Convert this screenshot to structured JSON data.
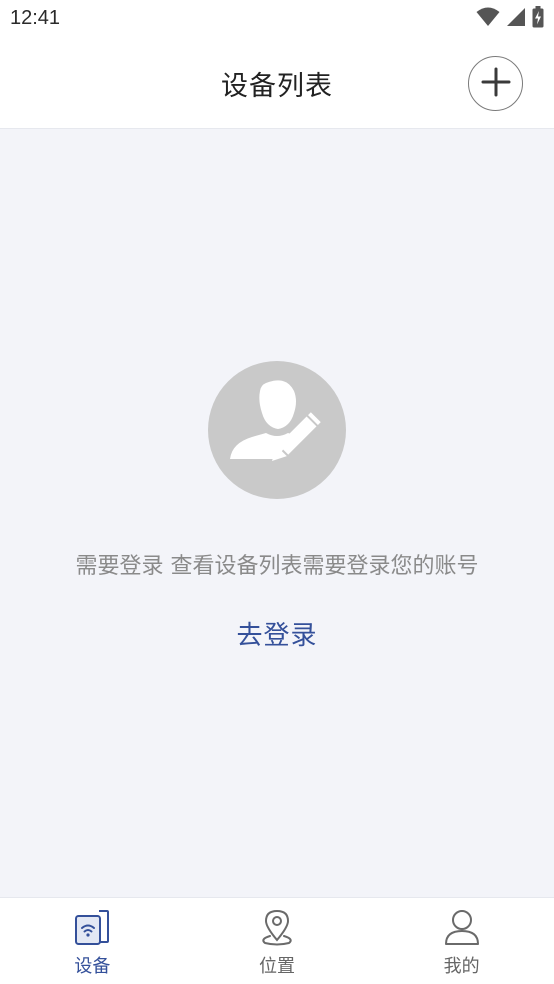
{
  "status_bar": {
    "time": "12:41",
    "icons": [
      "wifi-icon",
      "signal-icon",
      "battery-charging-icon"
    ]
  },
  "header": {
    "title": "设备列表",
    "add_icon": "plus-icon"
  },
  "main": {
    "avatar_icon": "user-edit-icon",
    "hint": "需要登录 查看设备列表需要登录您的账号",
    "login_link": "去登录"
  },
  "tabbar": {
    "tabs": [
      {
        "label": "设备",
        "icon": "device-wifi-icon",
        "active": true
      },
      {
        "label": "位置",
        "icon": "location-pin-icon",
        "active": false
      },
      {
        "label": "我的",
        "icon": "user-icon",
        "active": false
      }
    ]
  },
  "colors": {
    "accent": "#34509a",
    "background": "#f3f4f9",
    "avatar_bg": "#c9c9c9",
    "hint_text": "#8a8a8a"
  }
}
